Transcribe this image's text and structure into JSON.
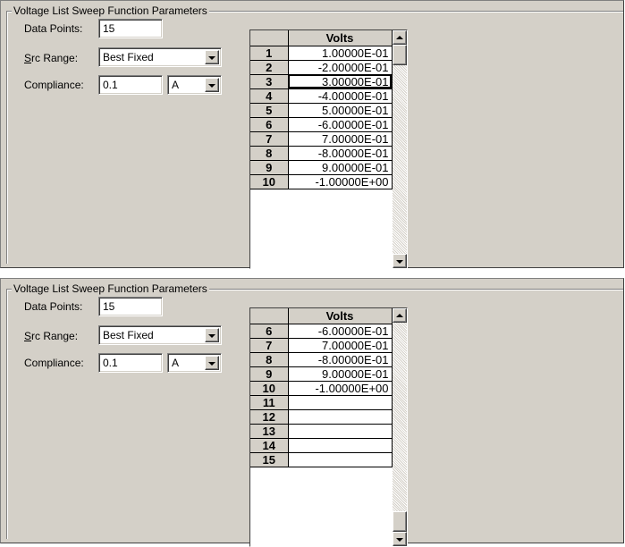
{
  "panels": [
    {
      "title": "Voltage List Sweep Function Parameters",
      "data_points": {
        "label": "Data Points:",
        "value": "15"
      },
      "src_range": {
        "label_accel": "S",
        "label_rest": "rc Range:",
        "value": "Best Fixed"
      },
      "compliance": {
        "label": "Compliance:",
        "value": "0.1",
        "unit": "A"
      },
      "table": {
        "header": "Volts",
        "rows": [
          {
            "n": "1",
            "v": "1.00000E-01"
          },
          {
            "n": "2",
            "v": "-2.00000E-01"
          },
          {
            "n": "3",
            "v": "3.00000E-01"
          },
          {
            "n": "4",
            "v": "-4.00000E-01"
          },
          {
            "n": "5",
            "v": "5.00000E-01"
          },
          {
            "n": "6",
            "v": "-6.00000E-01"
          },
          {
            "n": "7",
            "v": "7.00000E-01"
          },
          {
            "n": "8",
            "v": "-8.00000E-01"
          },
          {
            "n": "9",
            "v": "9.00000E-01"
          },
          {
            "n": "10",
            "v": "-1.00000E+00"
          }
        ],
        "selected_row": 2,
        "scroll_position": 0.0,
        "scroll_thumb_fraction": 0.1
      }
    },
    {
      "title": "Voltage List Sweep Function Parameters",
      "data_points": {
        "label": "Data Points:",
        "value": "15"
      },
      "src_range": {
        "label_accel": "S",
        "label_rest": "rc Range:",
        "value": "Best Fixed"
      },
      "compliance": {
        "label": "Compliance:",
        "value": "0.1",
        "unit": "A"
      },
      "table": {
        "header": "Volts",
        "rows": [
          {
            "n": "6",
            "v": "-6.00000E-01"
          },
          {
            "n": "7",
            "v": "7.00000E-01"
          },
          {
            "n": "8",
            "v": "-8.00000E-01"
          },
          {
            "n": "9",
            "v": "9.00000E-01"
          },
          {
            "n": "10",
            "v": "-1.00000E+00"
          },
          {
            "n": "11",
            "v": ""
          },
          {
            "n": "12",
            "v": ""
          },
          {
            "n": "13",
            "v": ""
          },
          {
            "n": "14",
            "v": ""
          },
          {
            "n": "15",
            "v": ""
          }
        ],
        "selected_row": -1,
        "scroll_position": 1.0,
        "scroll_thumb_fraction": 0.1
      }
    }
  ],
  "icons": [
    "dropdown-arrow-icon",
    "scroll-up-arrow-icon",
    "scroll-down-arrow-icon"
  ],
  "colors": {
    "face": "#d4d0c8",
    "window": "#ffffff",
    "shadow": "#808080"
  }
}
